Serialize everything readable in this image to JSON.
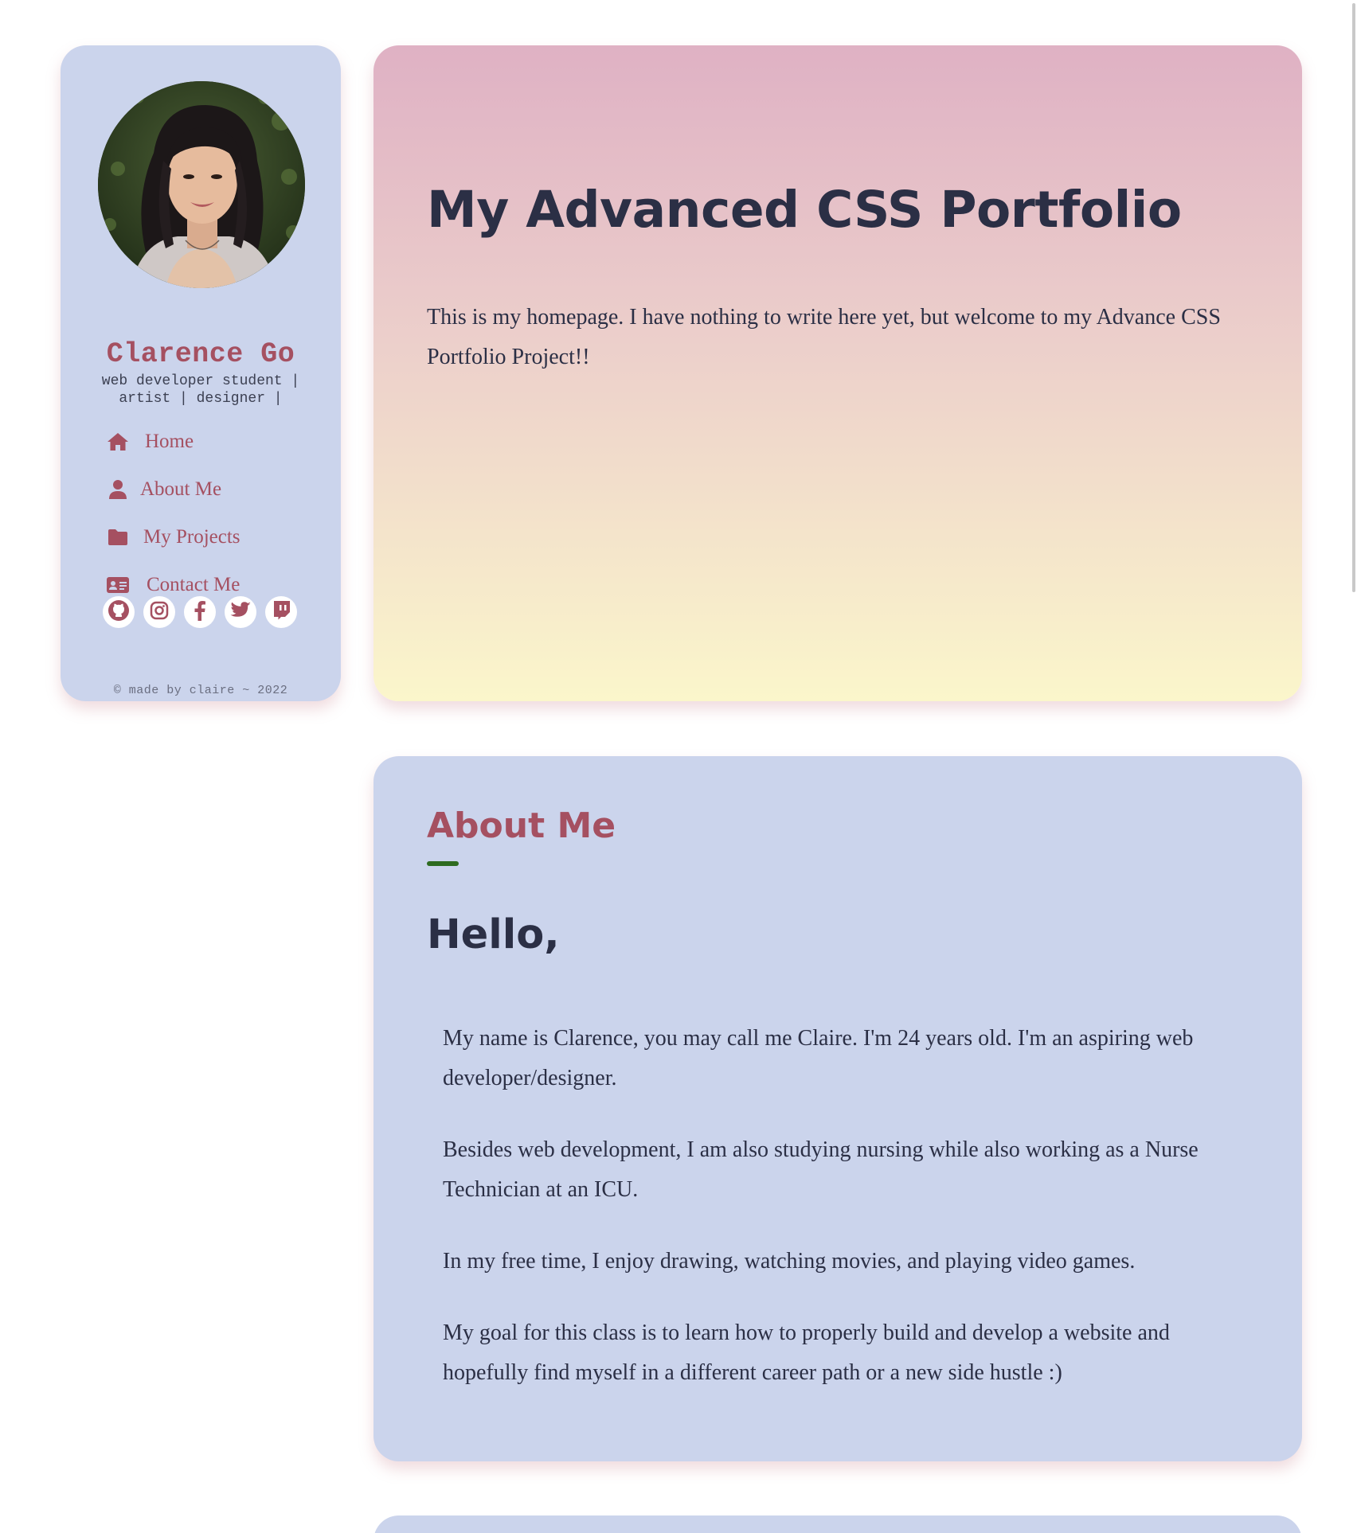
{
  "sidebar": {
    "avatar_alt": "Profile photo",
    "name": "Clarence Go",
    "tagline": "web developer student | artist | designer |",
    "nav": [
      {
        "icon": "home-icon",
        "label": "Home"
      },
      {
        "icon": "user-icon",
        "label": "About Me"
      },
      {
        "icon": "folder-icon",
        "label": "My Projects"
      },
      {
        "icon": "contact-card-icon",
        "label": "Contact Me"
      }
    ],
    "socials": [
      {
        "icon": "github-icon"
      },
      {
        "icon": "instagram-icon"
      },
      {
        "icon": "facebook-icon"
      },
      {
        "icon": "twitter-icon"
      },
      {
        "icon": "twitch-icon"
      }
    ],
    "copyright": "© made by claire ~ 2022"
  },
  "hero": {
    "title": "My Advanced CSS Portfolio",
    "text": "This is my homepage. I have nothing to write here yet, but welcome to my Advance CSS Portfolio Project!!"
  },
  "about": {
    "heading": "About Me",
    "greeting": "Hello,",
    "paragraphs": [
      "My name is Clarence, you may call me Claire. I'm 24 years old. I'm an aspiring web developer/designer.",
      "Besides web development, I am also studying nursing while also working as a Nurse Technician at an ICU.",
      "In my free time, I enjoy drawing, watching movies, and playing video games.",
      "My goal for this class is to learn how to properly build and develop a website and hopefully find myself in a different career path or a new side hustle :)"
    ]
  },
  "colors": {
    "accent": "#a55061",
    "card_blue": "#cbd4ec",
    "text_dark": "#2b2f45",
    "underline_green": "#2e6b20"
  }
}
